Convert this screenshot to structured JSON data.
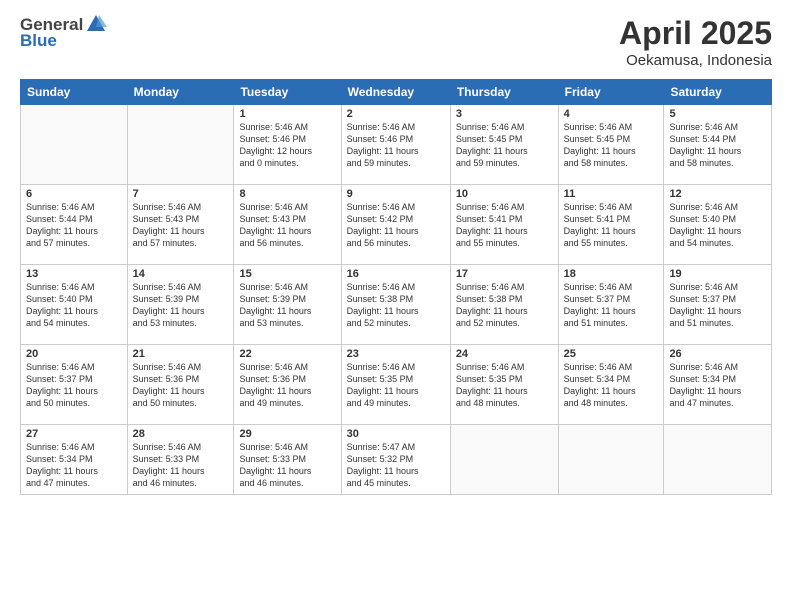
{
  "header": {
    "logo_general": "General",
    "logo_blue": "Blue",
    "month_title": "April 2025",
    "location": "Oekamusa, Indonesia"
  },
  "days_of_week": [
    "Sunday",
    "Monday",
    "Tuesday",
    "Wednesday",
    "Thursday",
    "Friday",
    "Saturday"
  ],
  "weeks": [
    [
      {
        "day": "",
        "info": ""
      },
      {
        "day": "",
        "info": ""
      },
      {
        "day": "1",
        "info": "Sunrise: 5:46 AM\nSunset: 5:46 PM\nDaylight: 12 hours\nand 0 minutes."
      },
      {
        "day": "2",
        "info": "Sunrise: 5:46 AM\nSunset: 5:46 PM\nDaylight: 11 hours\nand 59 minutes."
      },
      {
        "day": "3",
        "info": "Sunrise: 5:46 AM\nSunset: 5:45 PM\nDaylight: 11 hours\nand 59 minutes."
      },
      {
        "day": "4",
        "info": "Sunrise: 5:46 AM\nSunset: 5:45 PM\nDaylight: 11 hours\nand 58 minutes."
      },
      {
        "day": "5",
        "info": "Sunrise: 5:46 AM\nSunset: 5:44 PM\nDaylight: 11 hours\nand 58 minutes."
      }
    ],
    [
      {
        "day": "6",
        "info": "Sunrise: 5:46 AM\nSunset: 5:44 PM\nDaylight: 11 hours\nand 57 minutes."
      },
      {
        "day": "7",
        "info": "Sunrise: 5:46 AM\nSunset: 5:43 PM\nDaylight: 11 hours\nand 57 minutes."
      },
      {
        "day": "8",
        "info": "Sunrise: 5:46 AM\nSunset: 5:43 PM\nDaylight: 11 hours\nand 56 minutes."
      },
      {
        "day": "9",
        "info": "Sunrise: 5:46 AM\nSunset: 5:42 PM\nDaylight: 11 hours\nand 56 minutes."
      },
      {
        "day": "10",
        "info": "Sunrise: 5:46 AM\nSunset: 5:41 PM\nDaylight: 11 hours\nand 55 minutes."
      },
      {
        "day": "11",
        "info": "Sunrise: 5:46 AM\nSunset: 5:41 PM\nDaylight: 11 hours\nand 55 minutes."
      },
      {
        "day": "12",
        "info": "Sunrise: 5:46 AM\nSunset: 5:40 PM\nDaylight: 11 hours\nand 54 minutes."
      }
    ],
    [
      {
        "day": "13",
        "info": "Sunrise: 5:46 AM\nSunset: 5:40 PM\nDaylight: 11 hours\nand 54 minutes."
      },
      {
        "day": "14",
        "info": "Sunrise: 5:46 AM\nSunset: 5:39 PM\nDaylight: 11 hours\nand 53 minutes."
      },
      {
        "day": "15",
        "info": "Sunrise: 5:46 AM\nSunset: 5:39 PM\nDaylight: 11 hours\nand 53 minutes."
      },
      {
        "day": "16",
        "info": "Sunrise: 5:46 AM\nSunset: 5:38 PM\nDaylight: 11 hours\nand 52 minutes."
      },
      {
        "day": "17",
        "info": "Sunrise: 5:46 AM\nSunset: 5:38 PM\nDaylight: 11 hours\nand 52 minutes."
      },
      {
        "day": "18",
        "info": "Sunrise: 5:46 AM\nSunset: 5:37 PM\nDaylight: 11 hours\nand 51 minutes."
      },
      {
        "day": "19",
        "info": "Sunrise: 5:46 AM\nSunset: 5:37 PM\nDaylight: 11 hours\nand 51 minutes."
      }
    ],
    [
      {
        "day": "20",
        "info": "Sunrise: 5:46 AM\nSunset: 5:37 PM\nDaylight: 11 hours\nand 50 minutes."
      },
      {
        "day": "21",
        "info": "Sunrise: 5:46 AM\nSunset: 5:36 PM\nDaylight: 11 hours\nand 50 minutes."
      },
      {
        "day": "22",
        "info": "Sunrise: 5:46 AM\nSunset: 5:36 PM\nDaylight: 11 hours\nand 49 minutes."
      },
      {
        "day": "23",
        "info": "Sunrise: 5:46 AM\nSunset: 5:35 PM\nDaylight: 11 hours\nand 49 minutes."
      },
      {
        "day": "24",
        "info": "Sunrise: 5:46 AM\nSunset: 5:35 PM\nDaylight: 11 hours\nand 48 minutes."
      },
      {
        "day": "25",
        "info": "Sunrise: 5:46 AM\nSunset: 5:34 PM\nDaylight: 11 hours\nand 48 minutes."
      },
      {
        "day": "26",
        "info": "Sunrise: 5:46 AM\nSunset: 5:34 PM\nDaylight: 11 hours\nand 47 minutes."
      }
    ],
    [
      {
        "day": "27",
        "info": "Sunrise: 5:46 AM\nSunset: 5:34 PM\nDaylight: 11 hours\nand 47 minutes."
      },
      {
        "day": "28",
        "info": "Sunrise: 5:46 AM\nSunset: 5:33 PM\nDaylight: 11 hours\nand 46 minutes."
      },
      {
        "day": "29",
        "info": "Sunrise: 5:46 AM\nSunset: 5:33 PM\nDaylight: 11 hours\nand 46 minutes."
      },
      {
        "day": "30",
        "info": "Sunrise: 5:47 AM\nSunset: 5:32 PM\nDaylight: 11 hours\nand 45 minutes."
      },
      {
        "day": "",
        "info": ""
      },
      {
        "day": "",
        "info": ""
      },
      {
        "day": "",
        "info": ""
      }
    ]
  ]
}
